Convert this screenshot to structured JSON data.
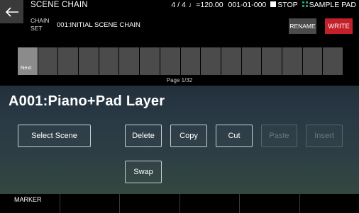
{
  "header": {
    "title": "SCENE CHAIN",
    "time_signature": "4 / 4",
    "note_symbol": "♩",
    "tempo": "=120.00",
    "position": "001-01-000",
    "transport": "STOP",
    "mode": "SAMPLE PAD"
  },
  "chain_set": {
    "label_line1": "CHAIN",
    "label_line2": "SET",
    "name": "001:INITIAL SCENE CHAIN",
    "rename_label": "RENAME",
    "write_label": "WRITE"
  },
  "chain": {
    "first_cell_label": "Next",
    "page": "Page 1/32"
  },
  "scene": {
    "name": "A001:Piano+Pad Layer"
  },
  "actions": {
    "select_scene": "Select Scene",
    "delete": "Delete",
    "copy": "Copy",
    "cut": "Cut",
    "paste": "Paste",
    "insert": "Insert",
    "swap": "Swap"
  },
  "function_bar": {
    "f1": "MARKER"
  },
  "colors": {
    "write": "#c4202a",
    "rename": "#4a4a4a",
    "sample_pad_icon": "#1aa36a"
  }
}
